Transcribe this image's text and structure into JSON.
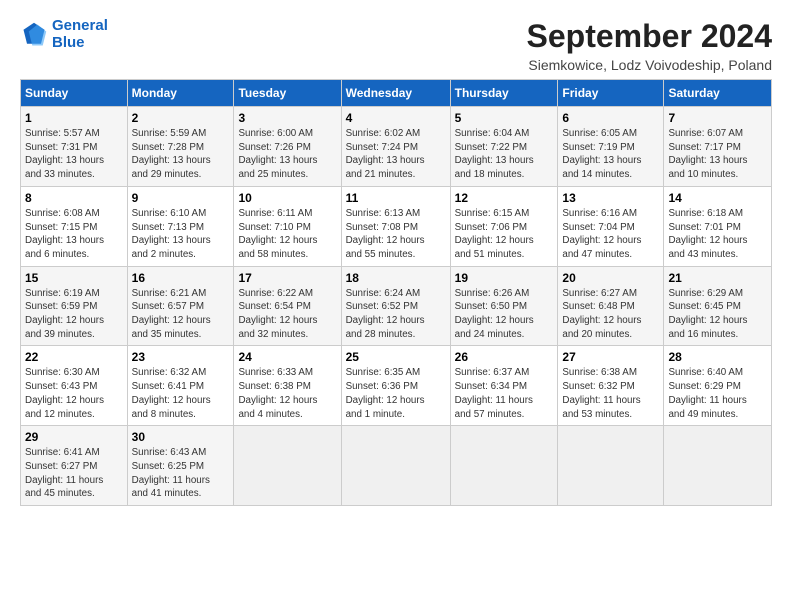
{
  "logo": {
    "line1": "General",
    "line2": "Blue"
  },
  "title": "September 2024",
  "subtitle": "Siemkowice, Lodz Voivodeship, Poland",
  "headers": [
    "Sunday",
    "Monday",
    "Tuesday",
    "Wednesday",
    "Thursday",
    "Friday",
    "Saturday"
  ],
  "weeks": [
    [
      {
        "day": "1",
        "info": "Sunrise: 5:57 AM\nSunset: 7:31 PM\nDaylight: 13 hours\nand 33 minutes."
      },
      {
        "day": "2",
        "info": "Sunrise: 5:59 AM\nSunset: 7:28 PM\nDaylight: 13 hours\nand 29 minutes."
      },
      {
        "day": "3",
        "info": "Sunrise: 6:00 AM\nSunset: 7:26 PM\nDaylight: 13 hours\nand 25 minutes."
      },
      {
        "day": "4",
        "info": "Sunrise: 6:02 AM\nSunset: 7:24 PM\nDaylight: 13 hours\nand 21 minutes."
      },
      {
        "day": "5",
        "info": "Sunrise: 6:04 AM\nSunset: 7:22 PM\nDaylight: 13 hours\nand 18 minutes."
      },
      {
        "day": "6",
        "info": "Sunrise: 6:05 AM\nSunset: 7:19 PM\nDaylight: 13 hours\nand 14 minutes."
      },
      {
        "day": "7",
        "info": "Sunrise: 6:07 AM\nSunset: 7:17 PM\nDaylight: 13 hours\nand 10 minutes."
      }
    ],
    [
      {
        "day": "8",
        "info": "Sunrise: 6:08 AM\nSunset: 7:15 PM\nDaylight: 13 hours\nand 6 minutes."
      },
      {
        "day": "9",
        "info": "Sunrise: 6:10 AM\nSunset: 7:13 PM\nDaylight: 13 hours\nand 2 minutes."
      },
      {
        "day": "10",
        "info": "Sunrise: 6:11 AM\nSunset: 7:10 PM\nDaylight: 12 hours\nand 58 minutes."
      },
      {
        "day": "11",
        "info": "Sunrise: 6:13 AM\nSunset: 7:08 PM\nDaylight: 12 hours\nand 55 minutes."
      },
      {
        "day": "12",
        "info": "Sunrise: 6:15 AM\nSunset: 7:06 PM\nDaylight: 12 hours\nand 51 minutes."
      },
      {
        "day": "13",
        "info": "Sunrise: 6:16 AM\nSunset: 7:04 PM\nDaylight: 12 hours\nand 47 minutes."
      },
      {
        "day": "14",
        "info": "Sunrise: 6:18 AM\nSunset: 7:01 PM\nDaylight: 12 hours\nand 43 minutes."
      }
    ],
    [
      {
        "day": "15",
        "info": "Sunrise: 6:19 AM\nSunset: 6:59 PM\nDaylight: 12 hours\nand 39 minutes."
      },
      {
        "day": "16",
        "info": "Sunrise: 6:21 AM\nSunset: 6:57 PM\nDaylight: 12 hours\nand 35 minutes."
      },
      {
        "day": "17",
        "info": "Sunrise: 6:22 AM\nSunset: 6:54 PM\nDaylight: 12 hours\nand 32 minutes."
      },
      {
        "day": "18",
        "info": "Sunrise: 6:24 AM\nSunset: 6:52 PM\nDaylight: 12 hours\nand 28 minutes."
      },
      {
        "day": "19",
        "info": "Sunrise: 6:26 AM\nSunset: 6:50 PM\nDaylight: 12 hours\nand 24 minutes."
      },
      {
        "day": "20",
        "info": "Sunrise: 6:27 AM\nSunset: 6:48 PM\nDaylight: 12 hours\nand 20 minutes."
      },
      {
        "day": "21",
        "info": "Sunrise: 6:29 AM\nSunset: 6:45 PM\nDaylight: 12 hours\nand 16 minutes."
      }
    ],
    [
      {
        "day": "22",
        "info": "Sunrise: 6:30 AM\nSunset: 6:43 PM\nDaylight: 12 hours\nand 12 minutes."
      },
      {
        "day": "23",
        "info": "Sunrise: 6:32 AM\nSunset: 6:41 PM\nDaylight: 12 hours\nand 8 minutes."
      },
      {
        "day": "24",
        "info": "Sunrise: 6:33 AM\nSunset: 6:38 PM\nDaylight: 12 hours\nand 4 minutes."
      },
      {
        "day": "25",
        "info": "Sunrise: 6:35 AM\nSunset: 6:36 PM\nDaylight: 12 hours\nand 1 minute."
      },
      {
        "day": "26",
        "info": "Sunrise: 6:37 AM\nSunset: 6:34 PM\nDaylight: 11 hours\nand 57 minutes."
      },
      {
        "day": "27",
        "info": "Sunrise: 6:38 AM\nSunset: 6:32 PM\nDaylight: 11 hours\nand 53 minutes."
      },
      {
        "day": "28",
        "info": "Sunrise: 6:40 AM\nSunset: 6:29 PM\nDaylight: 11 hours\nand 49 minutes."
      }
    ],
    [
      {
        "day": "29",
        "info": "Sunrise: 6:41 AM\nSunset: 6:27 PM\nDaylight: 11 hours\nand 45 minutes."
      },
      {
        "day": "30",
        "info": "Sunrise: 6:43 AM\nSunset: 6:25 PM\nDaylight: 11 hours\nand 41 minutes."
      },
      {
        "day": "",
        "info": ""
      },
      {
        "day": "",
        "info": ""
      },
      {
        "day": "",
        "info": ""
      },
      {
        "day": "",
        "info": ""
      },
      {
        "day": "",
        "info": ""
      }
    ]
  ]
}
